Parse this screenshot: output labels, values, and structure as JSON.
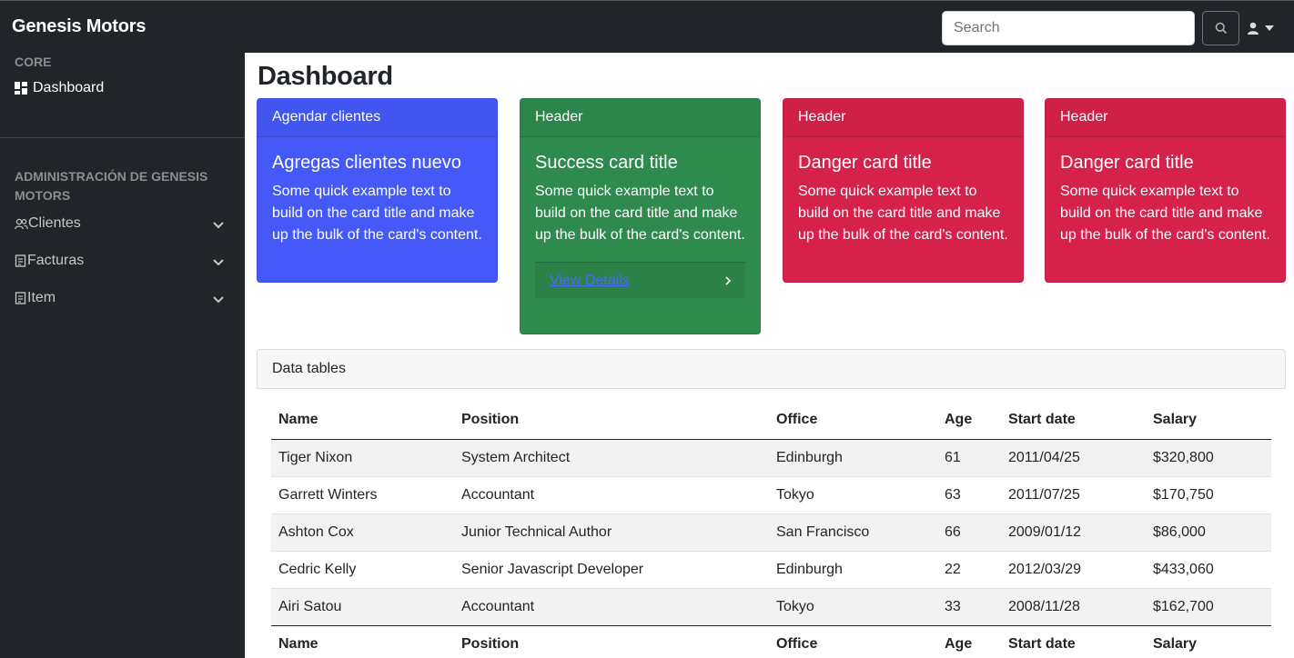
{
  "navbar": {
    "brand": "Genesis Motors",
    "search_placeholder": "Search"
  },
  "sidebar": {
    "core_heading": "CORE",
    "dashboard_label": "Dashboard",
    "admin_heading_line1": "ADMINISTRACIÓN DE GENESIS",
    "admin_heading_line2": "MOTORS",
    "items": [
      {
        "label": "Clientes",
        "icon": "users-icon"
      },
      {
        "label": "Facturas",
        "icon": "document-icon"
      },
      {
        "label": "Item",
        "icon": "document-icon"
      }
    ]
  },
  "main": {
    "title": "Dashboard",
    "cards": [
      {
        "header": "Agendar clientes",
        "title": "Agregas clientes nuevo",
        "text": "Some quick example text to build on the card title and make up the bulk of the card's content.",
        "color": "#4459f7"
      },
      {
        "header": "Header",
        "title": "Success card title",
        "text": "Some quick example text to build on the card title and make up the bulk of the card's content.",
        "footer_link": "View Details",
        "color": "#2e8a4d"
      },
      {
        "header": "Header",
        "title": "Danger card title",
        "text": "Some quick example text to build on the card title and make up the bulk of the card's content.",
        "color": "#d6224a"
      },
      {
        "header": "Header",
        "title": "Danger card title",
        "text": "Some quick example text to build on the card title and make up the bulk of the card's content.",
        "color": "#d6224a"
      }
    ],
    "datatable": {
      "header": "Data tables",
      "columns": [
        "Name",
        "Position",
        "Office",
        "Age",
        "Start date",
        "Salary"
      ],
      "rows": [
        [
          "Tiger Nixon",
          "System Architect",
          "Edinburgh",
          "61",
          "2011/04/25",
          "$320,800"
        ],
        [
          "Garrett Winters",
          "Accountant",
          "Tokyo",
          "63",
          "2011/07/25",
          "$170,750"
        ],
        [
          "Ashton Cox",
          "Junior Technical Author",
          "San Francisco",
          "66",
          "2009/01/12",
          "$86,000"
        ],
        [
          "Cedric Kelly",
          "Senior Javascript Developer",
          "Edinburgh",
          "22",
          "2012/03/29",
          "$433,060"
        ],
        [
          "Airi Satou",
          "Accountant",
          "Tokyo",
          "33",
          "2008/11/28",
          "$162,700"
        ]
      ]
    }
  }
}
